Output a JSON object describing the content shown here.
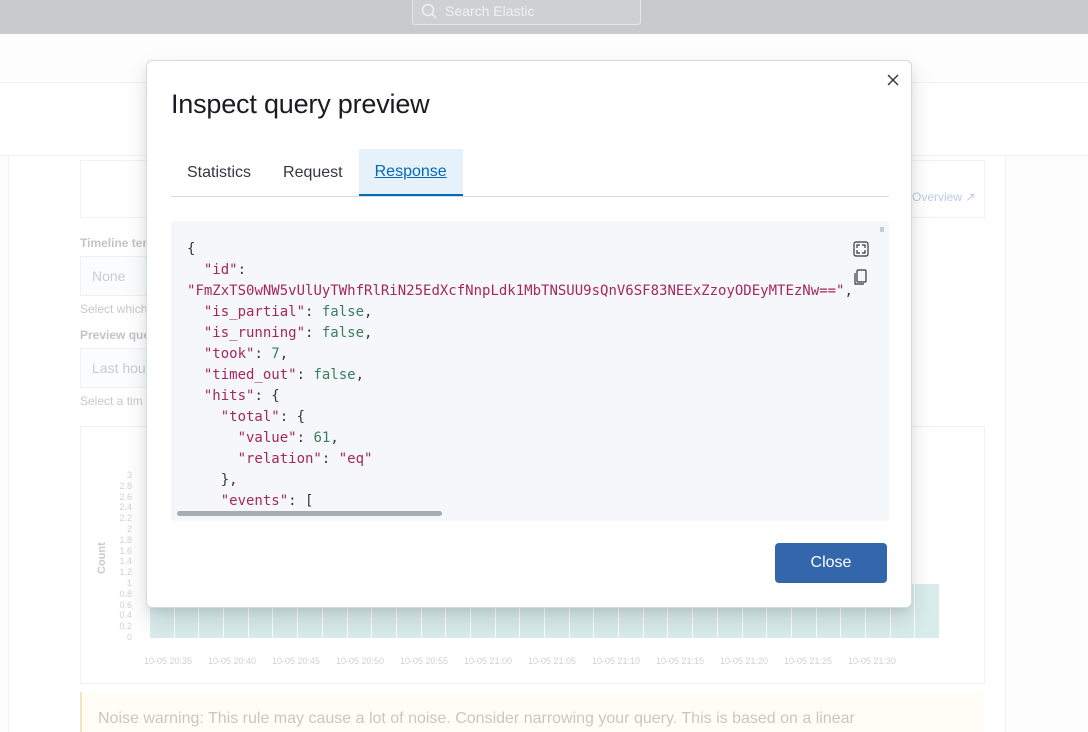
{
  "header": {
    "search_placeholder": "Search Elastic"
  },
  "background": {
    "link_overview": "Overview",
    "timeline_label": "Timeline ter",
    "timeline_value": "None",
    "timeline_help": "Select which",
    "preview_label": "Preview que",
    "preview_value": "Last hou",
    "preview_help": "Select a tim",
    "noise_warning": "Noise warning: This rule may cause a lot of noise. Consider narrowing your query. This is based on a linear"
  },
  "chart_data": {
    "type": "bar",
    "ylabel": "Count",
    "ylim": [
      0,
      3
    ],
    "yticks": [
      "3",
      "2.8",
      "2.6",
      "2.4",
      "2.2",
      "2",
      "1.8",
      "1.6",
      "1.4",
      "1.2",
      "1",
      "0.8",
      "0.6",
      "0.4",
      "0.2",
      "0"
    ],
    "xticks": [
      "10-05 20:35",
      "10-05 20:40",
      "10-05 20:45",
      "10-05 20:50",
      "10-05 20:55",
      "10-05 21:00",
      "10-05 21:05",
      "10-05 21:10",
      "10-05 21:15",
      "10-05 21:20",
      "10-05 21:25",
      "10-05 21:30"
    ],
    "values": [
      1,
      1,
      1,
      1,
      1,
      1,
      1,
      1,
      1,
      1,
      1,
      1,
      1,
      1,
      1,
      1,
      1,
      1,
      1,
      1,
      1,
      1,
      1,
      1,
      1,
      1,
      1,
      1,
      1,
      1,
      1,
      1
    ]
  },
  "modal": {
    "title": "Inspect query preview",
    "tabs": [
      {
        "label": "Statistics"
      },
      {
        "label": "Request"
      },
      {
        "label": "Response"
      }
    ],
    "active_tab": "Response",
    "close_label": "Close",
    "response": {
      "id": "FmZxTS0wNW5vUlUyTWhfRlRiN25EdXcfNnpLdk1MbTNSUU9sQnV6SF83NEExZzoyODEyMTEzNw==",
      "is_partial": "false",
      "is_running": "false",
      "took": "7",
      "timed_out": "false",
      "total_value": "61",
      "total_relation": "\"eq\""
    }
  }
}
